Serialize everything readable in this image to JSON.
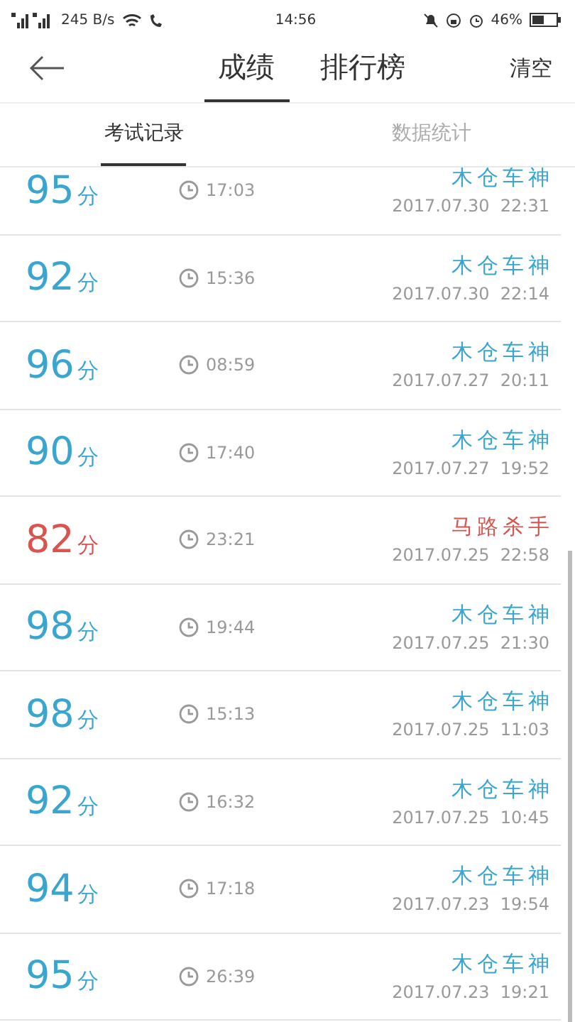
{
  "status_bar": {
    "network": "245 B/s",
    "time": "14:56",
    "battery": "46%"
  },
  "header": {
    "tabs": [
      {
        "label": "成绩",
        "selected": true
      },
      {
        "label": "排行榜",
        "selected": false
      }
    ],
    "action": "清空"
  },
  "sub_tabs": [
    {
      "label": "考试记录",
      "selected": true
    },
    {
      "label": "数据统计",
      "selected": false
    }
  ],
  "records": [
    {
      "score": "95",
      "unit": "分",
      "duration": "17:03",
      "title": "木仓车神",
      "date": "2017.07.30  22:31",
      "passed": true
    },
    {
      "score": "92",
      "unit": "分",
      "duration": "15:36",
      "title": "木仓车神",
      "date": "2017.07.30  22:14",
      "passed": true
    },
    {
      "score": "96",
      "unit": "分",
      "duration": "08:59",
      "title": "木仓车神",
      "date": "2017.07.27  20:11",
      "passed": true
    },
    {
      "score": "90",
      "unit": "分",
      "duration": "17:40",
      "title": "木仓车神",
      "date": "2017.07.27  19:52",
      "passed": true
    },
    {
      "score": "82",
      "unit": "分",
      "duration": "23:21",
      "title": "马路杀手",
      "date": "2017.07.25  22:58",
      "passed": false
    },
    {
      "score": "98",
      "unit": "分",
      "duration": "19:44",
      "title": "木仓车神",
      "date": "2017.07.25  21:30",
      "passed": true
    },
    {
      "score": "98",
      "unit": "分",
      "duration": "15:13",
      "title": "木仓车神",
      "date": "2017.07.25  11:03",
      "passed": true
    },
    {
      "score": "92",
      "unit": "分",
      "duration": "16:32",
      "title": "木仓车神",
      "date": "2017.07.25  10:45",
      "passed": true
    },
    {
      "score": "94",
      "unit": "分",
      "duration": "17:18",
      "title": "木仓车神",
      "date": "2017.07.23  19:54",
      "passed": true
    },
    {
      "score": "95",
      "unit": "分",
      "duration": "26:39",
      "title": "木仓车神",
      "date": "2017.07.23  19:21",
      "passed": true
    }
  ]
}
